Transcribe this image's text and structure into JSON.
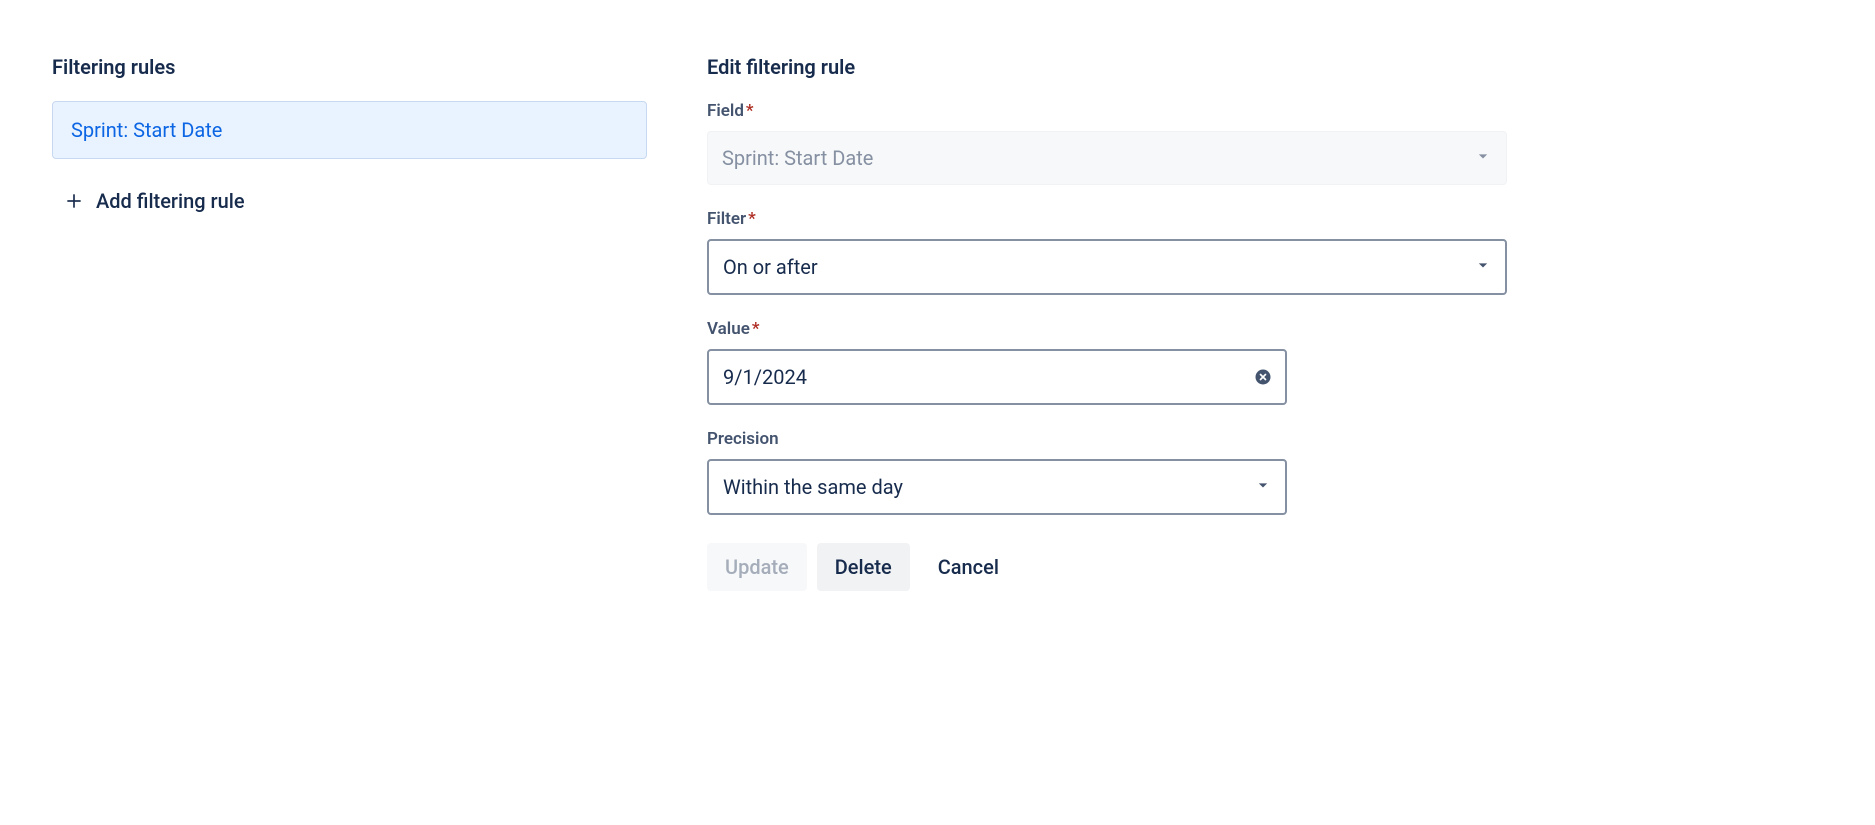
{
  "left": {
    "heading": "Filtering rules",
    "rules": [
      {
        "label": "Sprint: Start Date"
      }
    ],
    "addLabel": "Add filtering rule"
  },
  "right": {
    "heading": "Edit filtering rule",
    "fieldLabel": "Field",
    "fieldValue": "Sprint: Start Date",
    "filterLabel": "Filter",
    "filterValue": "On or after",
    "valueLabel": "Value",
    "valueValue": "9/1/2024",
    "precisionLabel": "Precision",
    "precisionValue": "Within the same day",
    "buttons": {
      "update": "Update",
      "delete": "Delete",
      "cancel": "Cancel"
    }
  }
}
